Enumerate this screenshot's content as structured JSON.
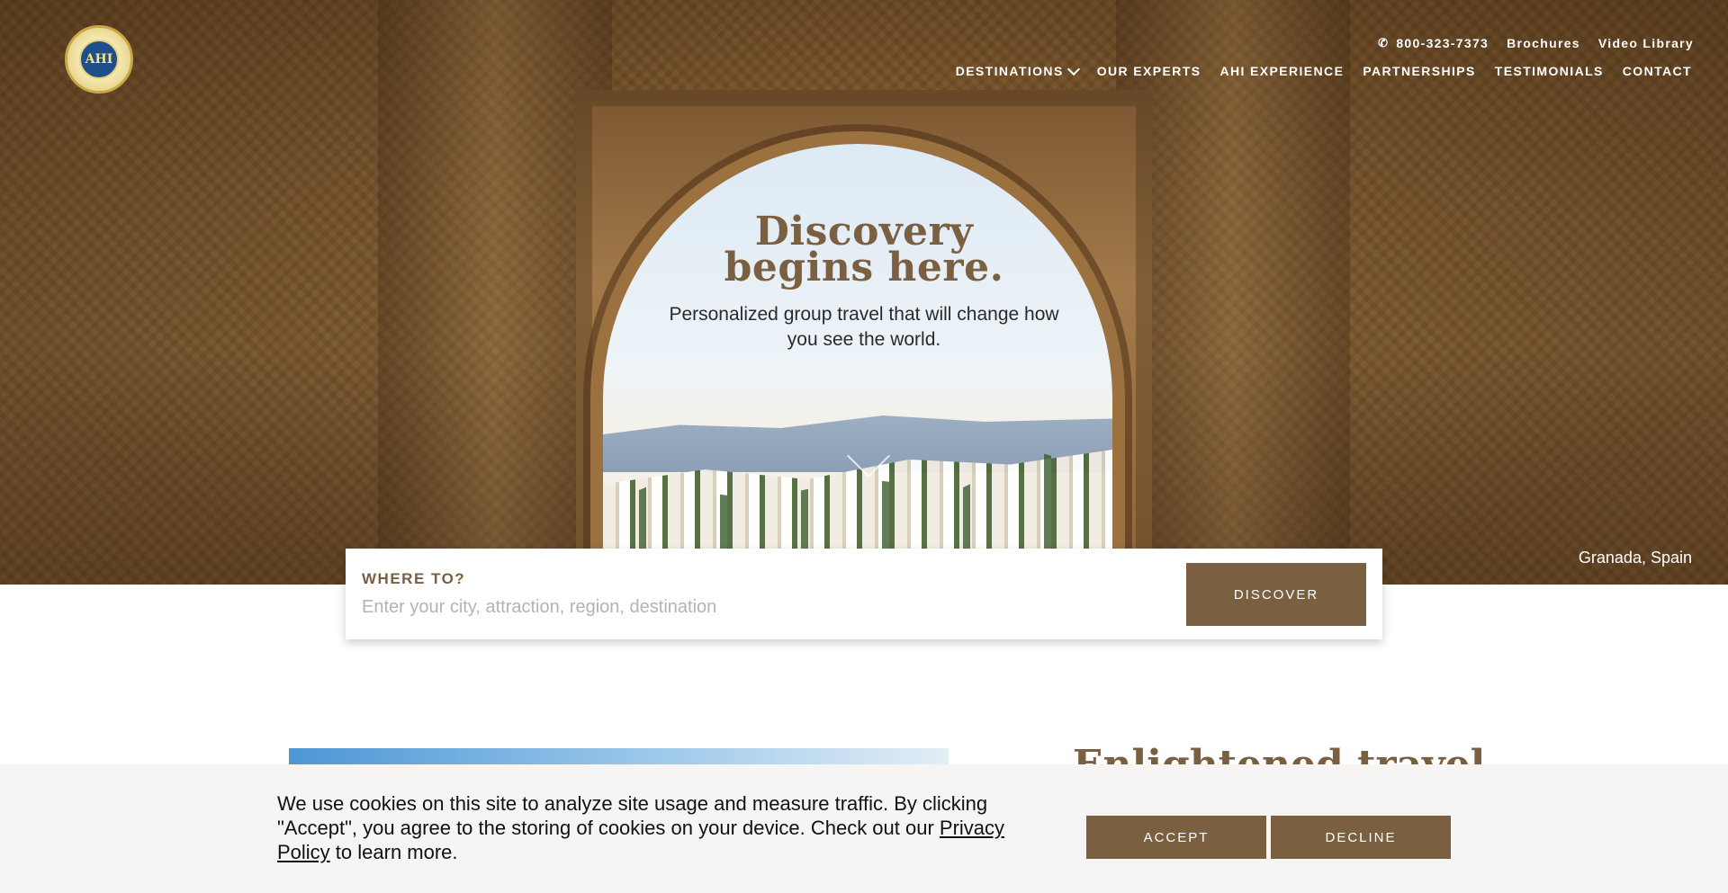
{
  "brand": {
    "logo_text": "AHI"
  },
  "utility_nav": {
    "phone": "800-323-7373",
    "links": [
      "Brochures",
      "Video Library"
    ]
  },
  "main_nav": {
    "items": [
      "DESTINATIONS",
      "OUR EXPERTS",
      "AHI EXPERIENCE",
      "PARTNERSHIPS",
      "TESTIMONIALS",
      "CONTACT"
    ]
  },
  "hero": {
    "headline_line1": "Discovery",
    "headline_line2": "begins here.",
    "subhead": "Personalized group travel that will change how you see the world.",
    "caption": "Granada, Spain"
  },
  "search": {
    "label": "WHERE TO?",
    "placeholder": "Enter your city, attraction, region, destination",
    "button": "DISCOVER"
  },
  "section": {
    "title": "Enlightened travel"
  },
  "cookie": {
    "text_before": "We use cookies on this site to analyze site usage and measure traffic. By clicking \"Accept\", you agree to the storing of cookies on your device. Check out our ",
    "link": "Privacy Policy",
    "text_after": " to learn more.",
    "accept": "ACCEPT",
    "decline": "DECLINE"
  },
  "colors": {
    "brand_brown": "#7a5f41",
    "cookie_bg": "#f6f5f3"
  },
  "icons": [
    "phone-icon",
    "chevron-down-icon",
    "scroll-down-icon"
  ]
}
